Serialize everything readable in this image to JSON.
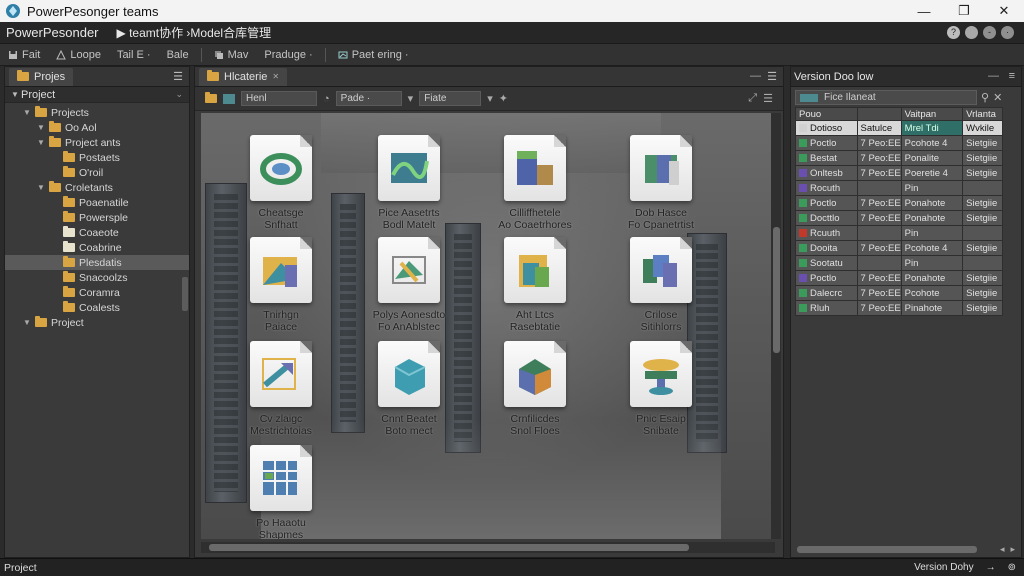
{
  "window": {
    "title": "PowerPesonger teams",
    "minimize": "—",
    "maximize": "❐",
    "close": "✕"
  },
  "appbar": {
    "app_name": "PowerPesonder",
    "crumb": "▶ teamt协作 ›Model合库管理"
  },
  "menubar": {
    "items": [
      {
        "label": "Fait",
        "icon": "save-icon"
      },
      {
        "label": "Loope",
        "icon": "triangle-icon"
      },
      {
        "label": "Tail E ·",
        "icon": ""
      },
      {
        "label": "Bale",
        "icon": ""
      },
      {
        "label": "Mav",
        "icon": "layers-icon"
      },
      {
        "label": "Praduge ·",
        "icon": ""
      },
      {
        "label": "Paet ering ·",
        "icon": "sketch-icon"
      }
    ]
  },
  "left_panel": {
    "tab": "Projes",
    "tree_header": "Project",
    "tree": [
      {
        "label": "Projects",
        "depth": 1,
        "arrow": "▼",
        "folder": "gold"
      },
      {
        "label": "Oo Aol",
        "depth": 2,
        "arrow": "▼",
        "folder": "gold"
      },
      {
        "label": "Project ants",
        "depth": 2,
        "arrow": "▼",
        "folder": "gold"
      },
      {
        "label": "Postaets",
        "depth": 3,
        "arrow": "",
        "folder": "gold"
      },
      {
        "label": "O'roil",
        "depth": 3,
        "arrow": "",
        "folder": "gold"
      },
      {
        "label": "Croletants",
        "depth": 2,
        "arrow": "▼",
        "folder": "gold"
      },
      {
        "label": "Poaenatile",
        "depth": 3,
        "arrow": "",
        "folder": "gold"
      },
      {
        "label": "Powersple",
        "depth": 3,
        "arrow": "",
        "folder": "gold"
      },
      {
        "label": "Coaeote",
        "depth": 3,
        "arrow": "",
        "folder": "pale"
      },
      {
        "label": "Coabrine",
        "depth": 3,
        "arrow": "",
        "folder": "pale"
      },
      {
        "label": "Plesdatis",
        "depth": 3,
        "arrow": "",
        "folder": "gold",
        "selected": true
      },
      {
        "label": "Snacoolzs",
        "depth": 3,
        "arrow": "",
        "folder": "gold"
      },
      {
        "label": "Coramra",
        "depth": 3,
        "arrow": "",
        "folder": "gold"
      },
      {
        "label": "Coalests",
        "depth": 3,
        "arrow": "",
        "folder": "gold"
      },
      {
        "label": "Project",
        "depth": 1,
        "arrow": "▼",
        "folder": "gold"
      }
    ]
  },
  "center_panel": {
    "tab": "Hlcaterie",
    "toolbar": {
      "field1": "Henl",
      "field2": "Pade ·",
      "field3": "Fiate"
    },
    "assets": [
      {
        "l1": "Cheatsge",
        "l2": "Snfhatt",
        "icon": "ring"
      },
      {
        "l1": "Pice Aasetrts",
        "l2": "Bodl Matelt",
        "icon": "wave"
      },
      {
        "l1": "Cilliffhetele",
        "l2": "Ao Coaetrhores",
        "icon": "boxes"
      },
      {
        "l1": "Dob Hasce",
        "l2": "Fo Cpanetrtist",
        "icon": "block"
      },
      {
        "l1": "Tnirhgn",
        "l2": "Paiace",
        "icon": "panels"
      },
      {
        "l1": "Polys Aonesdto",
        "l2": "Fo AnAblstec",
        "icon": "plane"
      },
      {
        "l1": "Aht Ltcs",
        "l2": "Rasebtatie",
        "icon": "stack"
      },
      {
        "l1": "Crilose",
        "l2": "Sitihlorrs",
        "icon": "cubes"
      },
      {
        "l1": "Cv zlaigc",
        "l2": "Mestrichtoias",
        "icon": "arrow"
      },
      {
        "l1": "Cnnt Beatet",
        "l2": "Boto mect",
        "icon": "cube"
      },
      {
        "l1": "Crnfilicdes",
        "l2": "Snol Floes",
        "icon": "halfcube"
      },
      {
        "l1": "Pnic Esaip",
        "l2": "Snibate",
        "icon": "tray"
      },
      {
        "l1": "Po Haaotu",
        "l2": "Shapmes",
        "icon": "grid"
      }
    ]
  },
  "right_panel": {
    "title": "Version Doo low",
    "search": "Fice Ilaneat",
    "columns": [
      "Pouo",
      "Vaitpan",
      "Vrlanta"
    ],
    "rows": [
      {
        "c1": "Dotioso",
        "c2": "Satulce",
        "c3": "Mrel Tdi",
        "c4": "Wvkile",
        "color": "#d0d0d0",
        "hl": true
      },
      {
        "c1": "Poctlo",
        "c2": "7 Peo:EE",
        "c3": "Pcohote 4",
        "c4": "Sietgiie",
        "color": "#3b9b5a"
      },
      {
        "c1": "Bestat",
        "c2": "7 Peo:EE",
        "c3": "Ponalite",
        "c4": "Sietgiie",
        "color": "#3b9b5a"
      },
      {
        "c1": "Onltesb",
        "c2": "7 Peo:EE",
        "c3": "Poeretie 4",
        "c4": "Sietgiie",
        "color": "#6a4fb0"
      },
      {
        "c1": "Rocuth",
        "c2": "",
        "c3": "Pin",
        "c4": "",
        "color": "#6a4fb0"
      },
      {
        "c1": "Poctlo",
        "c2": "7 Peo:EE",
        "c3": "Ponahote",
        "c4": "Sietgiie",
        "color": "#3b9b5a"
      },
      {
        "c1": "Docttlo",
        "c2": "7 Peo:EE",
        "c3": "Ponahote",
        "c4": "Sietgiie",
        "color": "#3b9b5a"
      },
      {
        "c1": "Rcuuth",
        "c2": "",
        "c3": "Pin",
        "c4": "",
        "color": "#c0392b"
      },
      {
        "c1": "Dooita",
        "c2": "7 Peo:EE",
        "c3": "Pcohote 4",
        "c4": "Sietgiie",
        "color": "#3b9b5a"
      },
      {
        "c1": "Sootatu",
        "c2": "",
        "c3": "Pin",
        "c4": "",
        "color": "#3b9b5a"
      },
      {
        "c1": "Poctlo",
        "c2": "7 Peo:EE",
        "c3": "Ponahote",
        "c4": "Sietgiie",
        "color": "#6a4fb0"
      },
      {
        "c1": "Dalecrc",
        "c2": "7 Peo:EE",
        "c3": "Pcohote",
        "c4": "Sietgiie",
        "color": "#3b9b5a"
      },
      {
        "c1": "Rluh",
        "c2": "7 Peo:EE",
        "c3": "Pinahote",
        "c4": "Sietgiie",
        "color": "#3b9b5a"
      }
    ]
  },
  "statusbar": {
    "left": "Project",
    "right": "Version Dohy"
  }
}
